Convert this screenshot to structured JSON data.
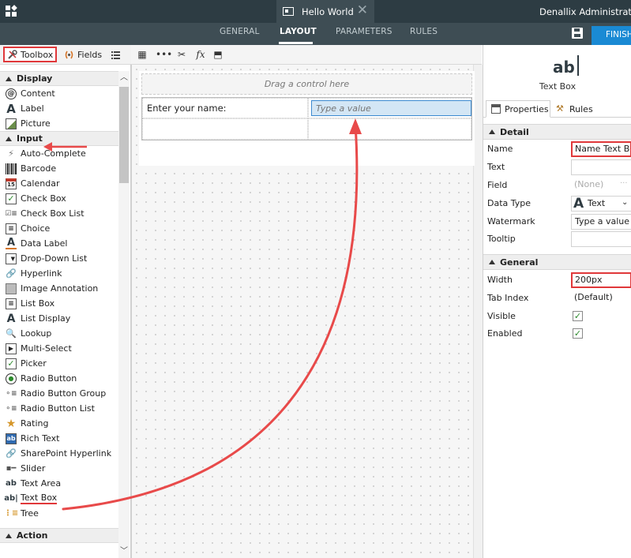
{
  "header": {
    "document_title": "Hello World",
    "user_name": "Denallix Administrator (",
    "nav_tabs": [
      "GENERAL",
      "LAYOUT",
      "PARAMETERS",
      "RULES"
    ],
    "active_tab": "LAYOUT",
    "finish_label": "FINISH"
  },
  "toolbox": {
    "tabs": {
      "toolbox": "Toolbox",
      "fields": "Fields"
    },
    "sections": {
      "display": "Display",
      "input": "Input",
      "action": "Action"
    },
    "display_items": [
      "Content",
      "Label",
      "Picture"
    ],
    "input_items": [
      "Auto-Complete",
      "Barcode",
      "Calendar",
      "Check Box",
      "Check Box List",
      "Choice",
      "Data Label",
      "Drop-Down List",
      "Hyperlink",
      "Image Annotation",
      "List Box",
      "List Display",
      "Lookup",
      "Multi-Select",
      "Picker",
      "Radio Button",
      "Radio Button Group",
      "Radio Button List",
      "Rating",
      "Rich Text",
      "SharePoint Hyperlink",
      "Slider",
      "Text Area",
      "Text Box",
      "Tree"
    ]
  },
  "canvas": {
    "drag_hint": "Drag a control here",
    "name_label": "Enter your name:",
    "name_placeholder": "Type a value"
  },
  "properties": {
    "control_icon": "ab",
    "control_type": "Text Box",
    "tabs": {
      "properties": "Properties",
      "rules": "Rules"
    },
    "detail_section": "Detail",
    "general_section": "General",
    "fields": {
      "name_label": "Name",
      "name_value": "Name Text Bo",
      "text_label": "Text",
      "text_value": "",
      "field_label": "Field",
      "field_value": "(None)",
      "datatype_label": "Data Type",
      "datatype_value": "Text",
      "watermark_label": "Watermark",
      "watermark_value": "Type a value",
      "tooltip_label": "Tooltip",
      "tooltip_value": "",
      "width_label": "Width",
      "width_value": "200px",
      "tabindex_label": "Tab Index",
      "tabindex_value": "(Default)",
      "visible_label": "Visible",
      "visible_checked": true,
      "enabled_label": "Enabled",
      "enabled_checked": true
    }
  },
  "colors": {
    "topbar": "#2d3c43",
    "navbar": "#3e4d54",
    "accent_blue": "#1a8ad4",
    "highlight_red": "#e0383a"
  }
}
